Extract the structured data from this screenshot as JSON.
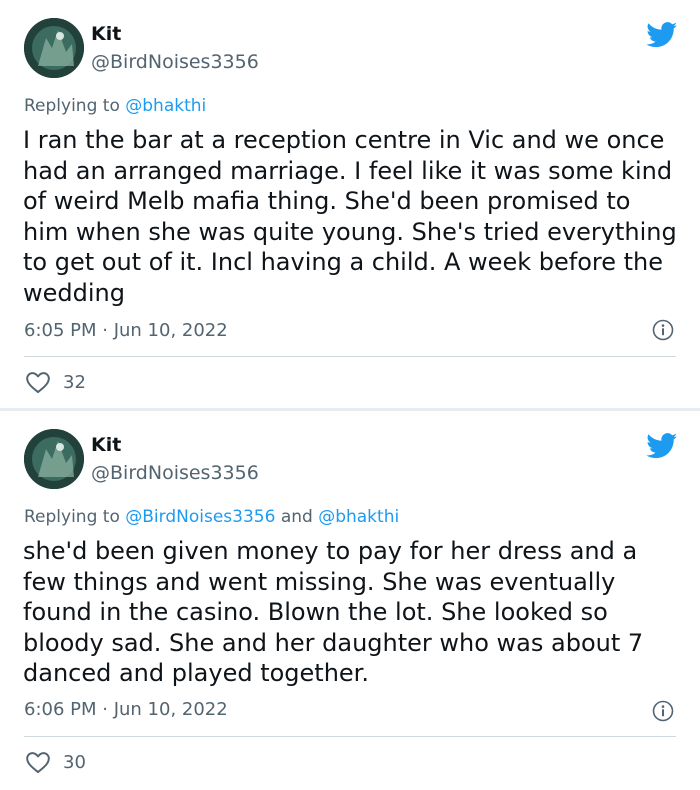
{
  "colors": {
    "twitter_blue": "#1d9bf0",
    "secondary_text": "#536471",
    "primary_text": "#0f1419",
    "divider": "#cfd9de",
    "gap_background": "#e6ecf0"
  },
  "tweets": [
    {
      "author_name": "Kit",
      "author_handle": "@BirdNoises3356",
      "replying_prefix": "Replying to",
      "replying_mentions": "@bhakthi",
      "replying_joiner": "",
      "replying_mention_2": "",
      "text": "I ran the bar at a reception centre in Vic and we once had an arranged marriage. I feel like it was some kind of weird Melb mafia thing. She'd been promised to him when she was quite young. She's tried everything to get out of it. Incl having a child. A week before the wedding",
      "timestamp": "6:05 PM · Jun 10, 2022",
      "like_count": "32",
      "icons": {
        "brand": "twitter-bird-icon",
        "info": "info-icon",
        "like": "heart-icon"
      }
    },
    {
      "author_name": "Kit",
      "author_handle": "@BirdNoises3356",
      "replying_prefix": "Replying to",
      "replying_mentions": "@BirdNoises3356",
      "replying_joiner": "and",
      "replying_mention_2": "@bhakthi",
      "text": "she'd been given money to pay for her dress and a few things and went missing. She was eventually found in the casino. Blown the lot. She looked so bloody sad. She and her daughter who was about 7 danced and played together.",
      "timestamp": "6:06 PM · Jun 10, 2022",
      "like_count": "30",
      "icons": {
        "brand": "twitter-bird-icon",
        "info": "info-icon",
        "like": "heart-icon"
      }
    }
  ]
}
